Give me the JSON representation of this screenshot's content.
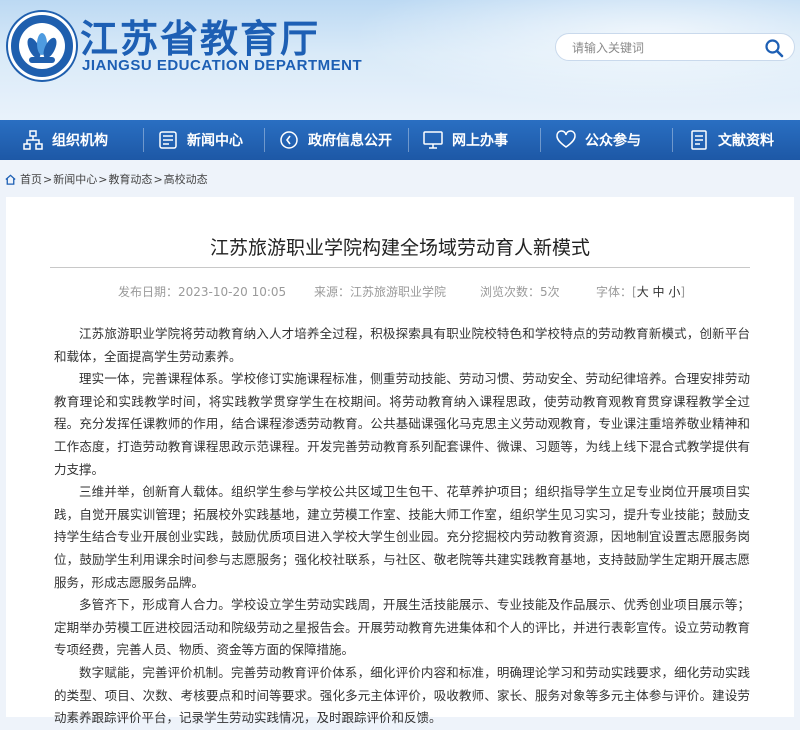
{
  "header": {
    "site_title": "江苏省教育厅",
    "site_subtitle": "JIANGSU EDUCATION DEPARTMENT",
    "search_placeholder": "请输入关键词",
    "brand_color": "#1d5fb4"
  },
  "nav": {
    "items": [
      {
        "label": "组织机构",
        "icon": "org-chart-icon"
      },
      {
        "label": "新闻中心",
        "icon": "news-icon"
      },
      {
        "label": "政府信息公开",
        "icon": "info-disclosure-icon"
      },
      {
        "label": "网上办事",
        "icon": "online-service-icon"
      },
      {
        "label": "公众参与",
        "icon": "heart-icon"
      },
      {
        "label": "文献资料",
        "icon": "documents-icon"
      }
    ],
    "bg_color": "#2a6fc2"
  },
  "breadcrumb": {
    "items": [
      "首页",
      "新闻中心",
      "教育动态",
      "高校动态"
    ],
    "separator": ">"
  },
  "article": {
    "title": "江苏旅游职业学院构建全场域劳动育人新模式",
    "publish_label": "发布日期：",
    "publish_date": "2023-10-20 10:05",
    "source_label": "来源：",
    "source": "江苏旅游职业学院",
    "views_label": "浏览次数：",
    "views": "5次",
    "fontsize_label": "字体：",
    "fontsize_options": [
      "大",
      "中",
      "小"
    ],
    "paragraphs": [
      "江苏旅游职业学院将劳动教育纳入人才培养全过程，积极探索具有职业院校特色和学校特点的劳动教育新模式，创新平台和载体，全面提高学生劳动素养。",
      "理实一体，完善课程体系。学校修订实施课程标准，侧重劳动技能、劳动习惯、劳动安全、劳动纪律培养。合理安排劳动教育理论和实践教学时间，将实践教学贯穿学生在校期间。将劳动教育纳入课程思政，使劳动教育观教育贯穿课程教学全过程。充分发挥任课教师的作用，结合课程渗透劳动教育。公共基础课强化马克思主义劳动观教育，专业课注重培养敬业精神和工作态度，打造劳动教育课程思政示范课程。开发完善劳动教育系列配套课件、微课、习题等，为线上线下混合式教学提供有力支撑。",
      "三维并举，创新育人载体。组织学生参与学校公共区域卫生包干、花草养护项目；组织指导学生立足专业岗位开展项目实践，自觉开展实训管理；拓展校外实践基地，建立劳模工作室、技能大师工作室，组织学生见习实习，提升专业技能；鼓励支持学生结合专业开展创业实践，鼓励优质项目进入学校大学生创业园。充分挖掘校内劳动教育资源，因地制宜设置志愿服务岗位，鼓励学生利用课余时间参与志愿服务；强化校社联系，与社区、敬老院等共建实践教育基地，支持鼓励学生定期开展志愿服务，形成志愿服务品牌。",
      "多管齐下，形成育人合力。学校设立学生劳动实践周，开展生活技能展示、专业技能及作品展示、优秀创业项目展示等；定期举办劳模工匠进校园活动和院级劳动之星报告会。开展劳动教育先进集体和个人的评比，并进行表彰宣传。设立劳动教育专项经费，完善人员、物质、资金等方面的保障措施。",
      "数字赋能，完善评价机制。完善劳动教育评价体系，细化评价内容和标准，明确理论学习和劳动实践要求，细化劳动实践的类型、项目、次数、考核要点和时间等要求。强化多元主体评价，吸收教师、家长、服务对象等多元主体参与评价。建设劳动素养跟踪评价平台，记录学生劳动实践情况，及时跟踪评价和反馈。"
    ]
  }
}
